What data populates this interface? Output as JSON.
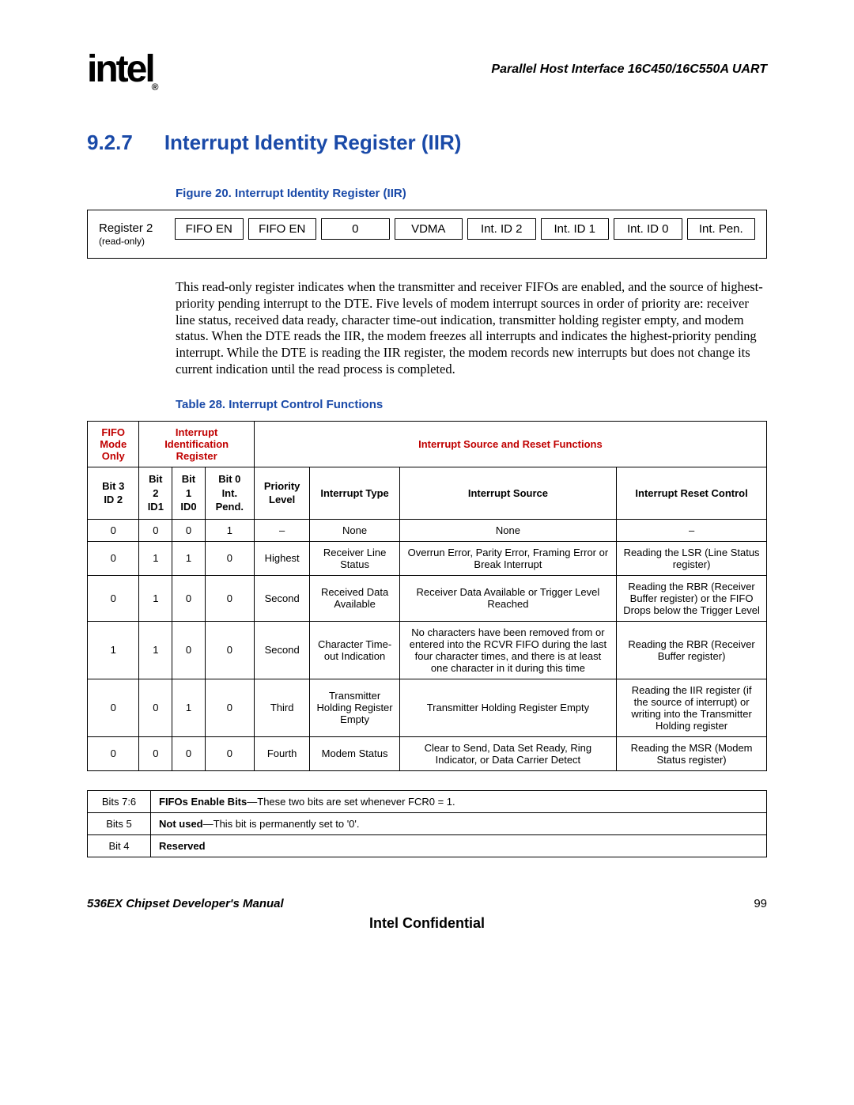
{
  "header": {
    "logo_text": "intel",
    "reg_mark": "®",
    "doc_title": "Parallel Host Interface 16C450/16C550A UART"
  },
  "section": {
    "number": "9.2.7",
    "title": "Interrupt Identity Register (IIR)"
  },
  "figure": {
    "title": "Figure 20. Interrupt Identity Register (IIR)",
    "reg_label": "Register 2",
    "reg_label_sub": "(read-only)",
    "cells": [
      "FIFO EN",
      "FIFO EN",
      "0",
      "VDMA",
      "Int. ID 2",
      "Int. ID 1",
      "Int. ID 0",
      "Int. Pen."
    ]
  },
  "body_para": "This read-only register indicates when the transmitter and receiver FIFOs are enabled, and the source of highest-priority pending interrupt to the DTE. Five levels of modem interrupt sources in order of priority are: receiver line status, received data ready, character time-out indication, transmitter holding register empty, and modem status. When the DTE reads the IIR, the modem freezes all interrupts and indicates the highest-priority pending interrupt. While the DTE is reading the IIR register, the modem records new interrupts but does not change its current indication until the read process is completed.",
  "table28": {
    "title": "Table 28.  Interrupt Control Functions",
    "group_headers": {
      "fifo": "FIFO Mode Only",
      "iir": "Interrupt Identification Register",
      "src": "Interrupt Source and Reset Functions"
    },
    "col_headers": {
      "bit3": "Bit 3\nID 2",
      "bit2": "Bit 2\nID1",
      "bit1": "Bit 1\nID0",
      "bit0": "Bit 0\nInt. Pend.",
      "prio": "Priority Level",
      "itype": "Interrupt Type",
      "isrc": "Interrupt Source",
      "irst": "Interrupt Reset Control"
    },
    "rows": [
      {
        "b3": "0",
        "b2": "0",
        "b1": "0",
        "b0": "1",
        "prio": "–",
        "itype": "None",
        "isrc": "None",
        "irst": "–"
      },
      {
        "b3": "0",
        "b2": "1",
        "b1": "1",
        "b0": "0",
        "prio": "Highest",
        "itype": "Receiver Line Status",
        "isrc": "Overrun Error, Parity Error, Framing Error or Break Interrupt",
        "irst": "Reading the LSR (Line Status register)"
      },
      {
        "b3": "0",
        "b2": "1",
        "b1": "0",
        "b0": "0",
        "prio": "Second",
        "itype": "Received Data Available",
        "isrc": "Receiver Data Available or Trigger Level Reached",
        "irst": "Reading the RBR (Receiver Buffer register) or the FIFO Drops below the Trigger Level"
      },
      {
        "b3": "1",
        "b2": "1",
        "b1": "0",
        "b0": "0",
        "prio": "Second",
        "itype": "Character Time-out Indication",
        "isrc": "No characters have been removed from or entered into the RCVR FIFO during the last four character times, and there is at least one character in it during this time",
        "irst": "Reading the RBR (Receiver Buffer register)"
      },
      {
        "b3": "0",
        "b2": "0",
        "b1": "1",
        "b0": "0",
        "prio": "Third",
        "itype": "Transmitter Holding Register Empty",
        "isrc": "Transmitter Holding Register Empty",
        "irst": "Reading the IIR register (if the source of interrupt) or writing into the Transmitter Holding register"
      },
      {
        "b3": "0",
        "b2": "0",
        "b1": "0",
        "b0": "0",
        "prio": "Fourth",
        "itype": "Modem Status",
        "isrc": "Clear to Send, Data Set Ready, Ring Indicator, or Data Carrier Detect",
        "irst": "Reading the MSR (Modem Status register)"
      }
    ]
  },
  "bits_table": {
    "rows": [
      {
        "label": "Bits 7:6",
        "bold": "FIFOs Enable Bits",
        "rest": "—These two bits are set whenever FCR0 = 1."
      },
      {
        "label": "Bits 5",
        "bold": "Not used",
        "rest": "—This bit is permanently set to '0'."
      },
      {
        "label": "Bit 4",
        "bold": "Reserved",
        "rest": ""
      }
    ]
  },
  "footer": {
    "left": "536EX Chipset Developer's Manual",
    "right": "99",
    "conf": "Intel Confidential"
  }
}
